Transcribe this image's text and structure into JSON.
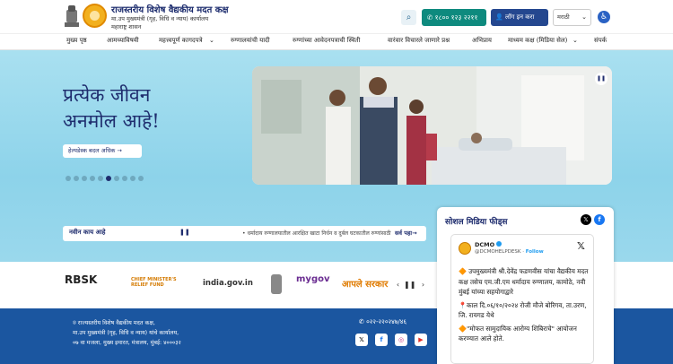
{
  "header": {
    "title": "राजस्तरीय विशेष वैद्यकीय मदत कक्ष",
    "subtitle": "मा.उप मुख्यमंत्री (गृह, विधि व न्याय) कार्यालय",
    "subtitle2": "महाराष्ट्र शासन",
    "phone_label": "१८०० १२३ २२११",
    "login_label": "लॉग इन करा",
    "language": "मराठी"
  },
  "nav": {
    "items": [
      "मुख्य पृष्ठ",
      "आमच्याविषयी",
      "महत्त्वपूर्ण कागदपत्रे",
      "रुग्णालयांची यादी",
      "रुग्णांच्या आवेदनपत्राची स्थिती",
      "वारंवार विचारले जाणारे प्रश्न",
      "अभिप्राय",
      "माध्यम कक्ष (मिडिया सेल)",
      "संपर्क"
    ]
  },
  "hero": {
    "title_line1": "प्रत्येक जीवन",
    "title_line2": "अनमोल आहे!",
    "button_label": "हेल्पडेस्क बदल अधिक →",
    "slide_count": 10,
    "active_slide": 5
  },
  "ticker": {
    "label": "नवीन काय आहे",
    "pause_glyph": "❚❚",
    "text": "• धर्मादाय रुग्णालयातील आरक्षित खाटा निर्धन व दुर्बल घटकातील रुग्णांसाठी पारद",
    "view_all": "सर्व पहा→"
  },
  "logos": [
    "RBSK",
    "CHIEF MINISTER'S RELIEF FUND",
    "india.gov.in",
    "mygov",
    "आपले सरकार"
  ],
  "footer": {
    "address_line1": "राज्यस्तरीय विशेष वैद्यकीय मदत कक्ष,",
    "address_line2": "मा.उप मुख्यमंत्री (गृह, विधि व न्याय) यांचे कार्यालय,",
    "address_line3": "०७ वा मजला, मुख्य इमारत, मंत्रालय, मुंबई: ४०००३२",
    "phone": "०२२-२२०२४७/४६"
  },
  "social": {
    "title": "सोशल मिडिया फीड्स",
    "tweet": {
      "name": "DCMO",
      "handle": "@DCMOHELPDESK",
      "follow": "Follow",
      "text_line1": "🔶 उपमुख्यमंत्री श्री.देवेंद्र फडणवीस यांचा वैद्यकीय मदत कक्ष  तसेच एम.जी.एम धर्मादाय रुग्णालय, कामोठे, नवी मुंबई यांच्या सहयोगाद्वारे",
      "text_line2": "📍काल दि.०६/१०/२०२४ रोजी  मौजे बोरिगव, ता.उरण, जि. रायगड येथे",
      "text_line3": "🔶\"मोफत सामुदायिक आरोग्य शिबिराचे\" आयोजन करण्यात आले होते."
    }
  },
  "colors": {
    "brand_blue": "#1f2d6e",
    "phone_green": "#0e8a7e",
    "login_blue": "#24478f",
    "hero_bg": "#a9e0f0",
    "footer_bg": "#1b56a0"
  }
}
